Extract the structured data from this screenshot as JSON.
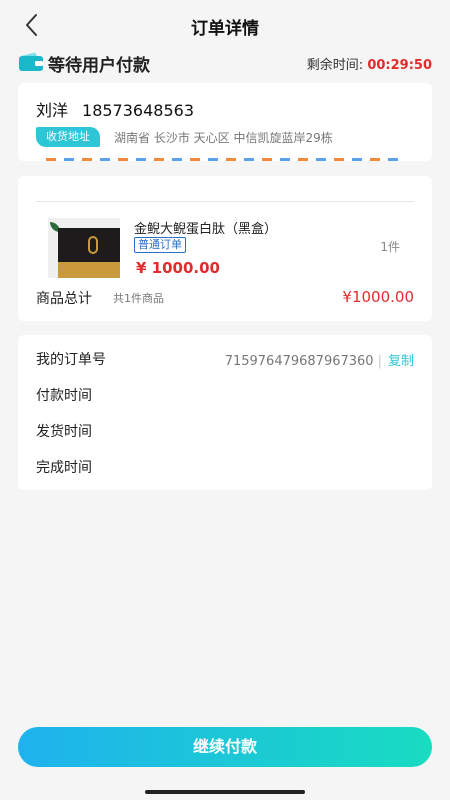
{
  "nav": {
    "title": "订单详情",
    "back_icon": "chevron-left-icon"
  },
  "status": {
    "icon": "wallet-icon",
    "label": "等待用户付款",
    "remain_label": "剩余时间:",
    "remain_time": "00:29:50",
    "accent_color": "#e02c2c"
  },
  "address": {
    "name": "刘洋",
    "phone": "18573648563",
    "tag": "收货地址",
    "detail": "湖南省 长沙市 天心区 中信凯旋蓝岸29栋"
  },
  "goods": {
    "name": "金鲵大鲵蛋白肽（黑盒）",
    "tag": "普通订单",
    "quantity": "1件",
    "price": "¥ 1000.00",
    "total_label": "商品总计",
    "total_count": "共1件商品",
    "total_price": "¥1000.00"
  },
  "order_info": {
    "order_no_label": "我的订单号",
    "order_no": "715976479687967360",
    "copy_label": "复制",
    "pay_time_label": "付款时间",
    "ship_time_label": "发货时间",
    "finish_time_label": "完成时间"
  },
  "actions": {
    "continue_pay": "继续付款"
  },
  "colors": {
    "brand_teal": "#2dc6d6",
    "price_red": "#e02c2c",
    "button_start": "#1fb2ee",
    "button_end": "#18dcc0"
  }
}
